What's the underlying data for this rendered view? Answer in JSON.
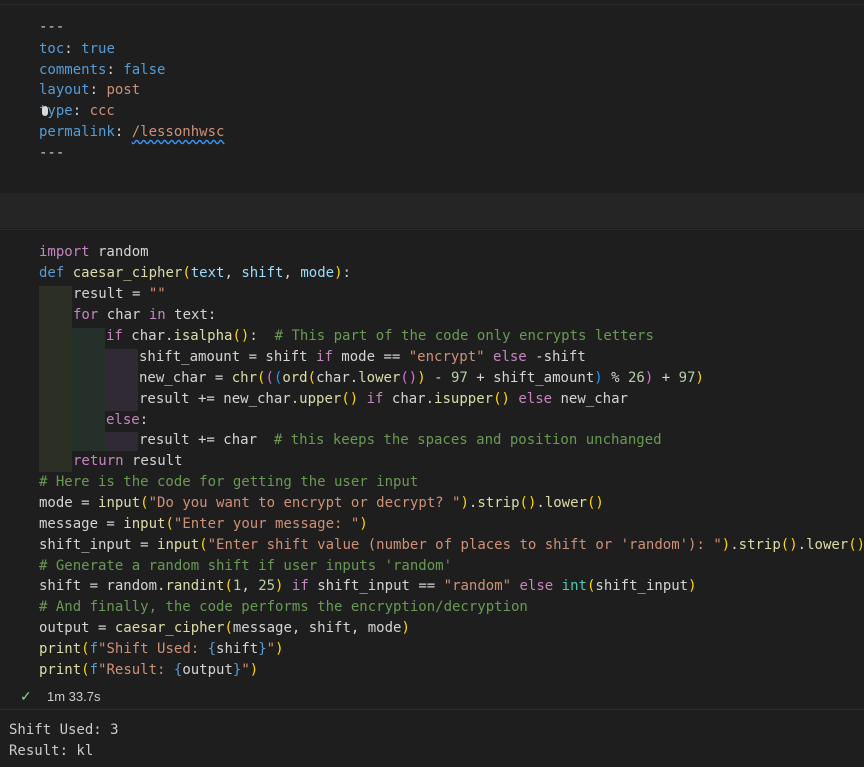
{
  "markdown_cell": {
    "lines": [
      "---",
      "toc",
      ": ",
      "true",
      "comments",
      ": ",
      "false",
      "layout",
      ": ",
      "post",
      "type",
      ": ",
      "ccc",
      "permalink",
      ": ",
      "/lessonhwsc",
      "---"
    ]
  },
  "code_cell": {
    "l1": [
      "import",
      " random"
    ],
    "l2": [
      "def",
      "caesar_cipher",
      "(",
      "text",
      ", ",
      "shift",
      ", ",
      "mode",
      ")",
      ":"
    ],
    "l3": [
      "result",
      " = ",
      "\"\""
    ],
    "l4": [
      "for",
      " char ",
      "in",
      " text:"
    ],
    "l5": [
      "if",
      " char.",
      "isalpha",
      "()",
      ":  ",
      "# This part of the code only encrypts letters"
    ],
    "l6": [
      "shift_amount = shift ",
      "if",
      " mode == ",
      "\"encrypt\"",
      " else",
      " -shift"
    ],
    "l7": [
      "new_char = ",
      "chr",
      "(",
      "(",
      "(",
      "ord",
      "(",
      "char.",
      "lower",
      "()",
      ")",
      " - ",
      "97",
      " + shift_amount",
      ")",
      " % ",
      "26",
      ")",
      " + ",
      "97",
      ")"
    ],
    "l8": [
      "result += new_char.",
      "upper",
      "()",
      " if",
      " char.",
      "isupper",
      "()",
      " else",
      " new_char"
    ],
    "l9": [
      "else",
      ":"
    ],
    "l10": [
      "result += char  ",
      "# this keeps the spaces and position unchanged"
    ],
    "l11": [
      "return",
      " result"
    ],
    "l12": [
      "# Here is the code for getting the user input"
    ],
    "l13": [
      "mode = ",
      "input",
      "(",
      "\"Do you want to encrypt or decrypt? \"",
      ")",
      ".",
      "strip",
      "()",
      ".",
      "lower",
      "()"
    ],
    "l14": [
      "message = ",
      "input",
      "(",
      "\"Enter your message: \"",
      ")"
    ],
    "l15": [
      "shift_input = ",
      "input",
      "(",
      "\"Enter shift value (number of places to shift or 'random'): \"",
      ")",
      ".",
      "strip",
      "()",
      ".",
      "lower",
      "()"
    ],
    "l16": [
      "# Generate a random shift if user inputs 'random'"
    ],
    "l17": [
      "shift = random.",
      "randint",
      "(",
      "1",
      ", ",
      "25",
      ")",
      " if",
      " shift_input == ",
      "\"random\"",
      " else ",
      "int",
      "(",
      "shift_input",
      ")"
    ],
    "l18": [
      "# And finally, the code performs the encryption/decryption"
    ],
    "l19": [
      "output = ",
      "caesar_cipher",
      "(",
      "message, shift, mode",
      ")"
    ],
    "l20": [
      "print",
      "(",
      "f",
      "\"Shift Used: ",
      "{",
      "shift",
      "}",
      "\"",
      ")"
    ],
    "l21": [
      "print",
      "(",
      "f",
      "\"Result: ",
      "{",
      "output",
      "}",
      "\"",
      ")"
    ]
  },
  "status": {
    "check": "✓",
    "duration": "1m 33.7s"
  },
  "output": {
    "line1": "Shift Used: 3",
    "line2": "Result: kl"
  }
}
